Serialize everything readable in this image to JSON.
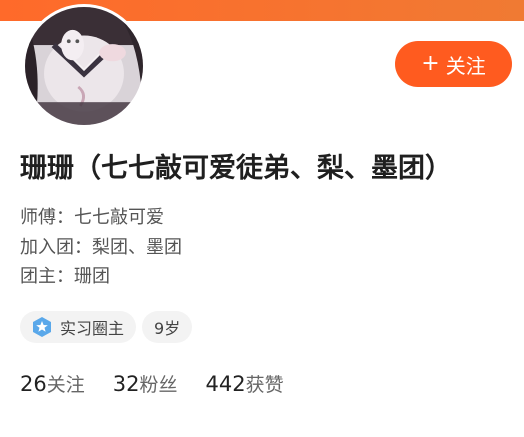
{
  "colors": {
    "accent": "#ff5b1f",
    "header_gradient": "#f07a33"
  },
  "avatar": {
    "icon": "user-avatar-photo"
  },
  "follow_button": {
    "icon": "plus-icon",
    "label": "关注"
  },
  "profile": {
    "name": "珊珊（七七敲可爱徒弟、梨、墨团）",
    "master": "师傅：七七敲可爱",
    "joined_groups": "加入团：梨团、墨团",
    "group_leader": "团主：珊团"
  },
  "tags": [
    {
      "icon": "intern-circle-badge-icon",
      "label": "实习圈主"
    },
    {
      "label": "9岁"
    }
  ],
  "stats": [
    {
      "count": "26",
      "label": "关注"
    },
    {
      "count": "32",
      "label": "粉丝"
    },
    {
      "count": "442",
      "label": "获赞"
    }
  ]
}
